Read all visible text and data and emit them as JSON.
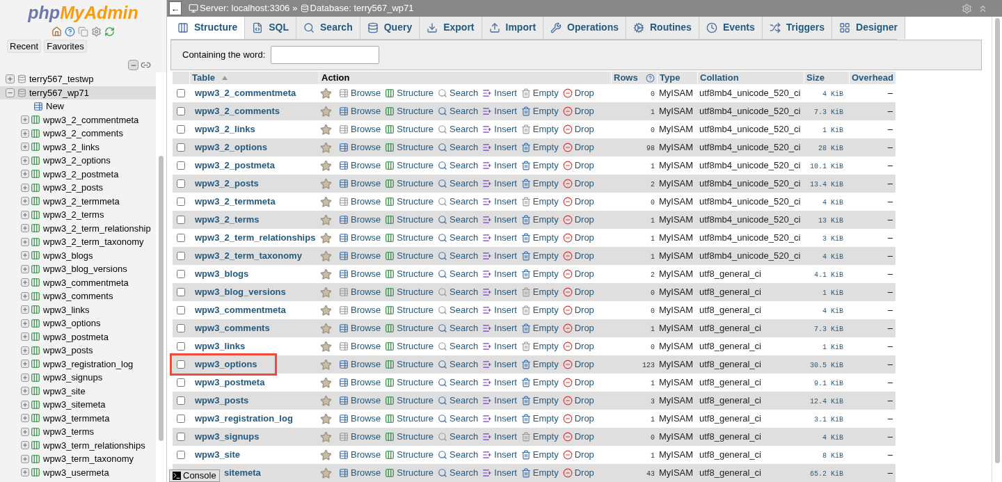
{
  "sidebar": {
    "logo": [
      "php",
      "MyAdmin"
    ],
    "buttons": [
      "Recent",
      "Favorites"
    ],
    "databases": [
      {
        "name": "terry567_testwp",
        "expanded": false,
        "selected": false
      },
      {
        "name": "terry567_wp71",
        "expanded": true,
        "selected": true,
        "children": [
          {
            "kind": "new",
            "name": "New"
          },
          {
            "kind": "table",
            "name": "wpw3_2_commentmeta"
          },
          {
            "kind": "table",
            "name": "wpw3_2_comments"
          },
          {
            "kind": "table",
            "name": "wpw3_2_links"
          },
          {
            "kind": "table",
            "name": "wpw3_2_options"
          },
          {
            "kind": "table",
            "name": "wpw3_2_postmeta"
          },
          {
            "kind": "table",
            "name": "wpw3_2_posts"
          },
          {
            "kind": "table",
            "name": "wpw3_2_termmeta"
          },
          {
            "kind": "table",
            "name": "wpw3_2_terms"
          },
          {
            "kind": "table",
            "name": "wpw3_2_term_relationship"
          },
          {
            "kind": "table",
            "name": "wpw3_2_term_taxonomy"
          },
          {
            "kind": "table",
            "name": "wpw3_blogs"
          },
          {
            "kind": "table",
            "name": "wpw3_blog_versions"
          },
          {
            "kind": "table",
            "name": "wpw3_commentmeta"
          },
          {
            "kind": "table",
            "name": "wpw3_comments"
          },
          {
            "kind": "table",
            "name": "wpw3_links"
          },
          {
            "kind": "table",
            "name": "wpw3_options"
          },
          {
            "kind": "table",
            "name": "wpw3_postmeta"
          },
          {
            "kind": "table",
            "name": "wpw3_posts"
          },
          {
            "kind": "table",
            "name": "wpw3_registration_log"
          },
          {
            "kind": "table",
            "name": "wpw3_signups"
          },
          {
            "kind": "table",
            "name": "wpw3_site"
          },
          {
            "kind": "table",
            "name": "wpw3_sitemeta"
          },
          {
            "kind": "table",
            "name": "wpw3_termmeta"
          },
          {
            "kind": "table",
            "name": "wpw3_terms"
          },
          {
            "kind": "table",
            "name": "wpw3_term_relationships"
          },
          {
            "kind": "table",
            "name": "wpw3_term_taxonomy"
          },
          {
            "kind": "table",
            "name": "wpw3_usermeta"
          }
        ]
      }
    ]
  },
  "breadcrumb": {
    "back": "←",
    "server": "Server: localhost:3306",
    "separator": "»",
    "database": "Database: terry567_wp71"
  },
  "tabs": [
    {
      "label": "Structure",
      "selected": true
    },
    {
      "label": "SQL",
      "selected": false
    },
    {
      "label": "Search",
      "selected": false
    },
    {
      "label": "Query",
      "selected": false
    },
    {
      "label": "Export",
      "selected": false
    },
    {
      "label": "Import",
      "selected": false
    },
    {
      "label": "Operations",
      "selected": false
    },
    {
      "label": "Routines",
      "selected": false
    },
    {
      "label": "Events",
      "selected": false
    },
    {
      "label": "Triggers",
      "selected": false
    },
    {
      "label": "Designer",
      "selected": false
    }
  ],
  "filter": {
    "label": "Containing the word:"
  },
  "table": {
    "columns": [
      "Table",
      "Action",
      "Rows",
      "Type",
      "Collation",
      "Size",
      "Overhead"
    ],
    "rows": [
      {
        "checked": false,
        "name": "wpw3_2_commentmeta",
        "actions": [
          "Browse",
          "Structure",
          "Search",
          "Insert",
          "Empty",
          "Drop"
        ],
        "rows": "0",
        "type": "MyISAM",
        "collation": "utf8mb4_unicode_520_ci",
        "size": "4 KiB",
        "overhead": "–",
        "empty": true,
        "highlighted": false
      },
      {
        "checked": false,
        "name": "wpw3_2_comments",
        "actions": [
          "Browse",
          "Structure",
          "Search",
          "Insert",
          "Empty",
          "Drop"
        ],
        "rows": "1",
        "type": "MyISAM",
        "collation": "utf8mb4_unicode_520_ci",
        "size": "7.3 KiB",
        "overhead": "–",
        "empty": false,
        "highlighted": false
      },
      {
        "checked": false,
        "name": "wpw3_2_links",
        "actions": [
          "Browse",
          "Structure",
          "Search",
          "Insert",
          "Empty",
          "Drop"
        ],
        "rows": "0",
        "type": "MyISAM",
        "collation": "utf8mb4_unicode_520_ci",
        "size": "1 KiB",
        "overhead": "–",
        "empty": true,
        "highlighted": false
      },
      {
        "checked": false,
        "name": "wpw3_2_options",
        "actions": [
          "Browse",
          "Structure",
          "Search",
          "Insert",
          "Empty",
          "Drop"
        ],
        "rows": "98",
        "type": "MyISAM",
        "collation": "utf8mb4_unicode_520_ci",
        "size": "28 KiB",
        "overhead": "–",
        "empty": false,
        "highlighted": false
      },
      {
        "checked": false,
        "name": "wpw3_2_postmeta",
        "actions": [
          "Browse",
          "Structure",
          "Search",
          "Insert",
          "Empty",
          "Drop"
        ],
        "rows": "1",
        "type": "MyISAM",
        "collation": "utf8mb4_unicode_520_ci",
        "size": "10.1 KiB",
        "overhead": "–",
        "empty": false,
        "highlighted": false
      },
      {
        "checked": false,
        "name": "wpw3_2_posts",
        "actions": [
          "Browse",
          "Structure",
          "Search",
          "Insert",
          "Empty",
          "Drop"
        ],
        "rows": "2",
        "type": "MyISAM",
        "collation": "utf8mb4_unicode_520_ci",
        "size": "13.4 KiB",
        "overhead": "–",
        "empty": false,
        "highlighted": false
      },
      {
        "checked": false,
        "name": "wpw3_2_termmeta",
        "actions": [
          "Browse",
          "Structure",
          "Search",
          "Insert",
          "Empty",
          "Drop"
        ],
        "rows": "0",
        "type": "MyISAM",
        "collation": "utf8mb4_unicode_520_ci",
        "size": "4 KiB",
        "overhead": "–",
        "empty": true,
        "highlighted": false
      },
      {
        "checked": false,
        "name": "wpw3_2_terms",
        "actions": [
          "Browse",
          "Structure",
          "Search",
          "Insert",
          "Empty",
          "Drop"
        ],
        "rows": "1",
        "type": "MyISAM",
        "collation": "utf8mb4_unicode_520_ci",
        "size": "13 KiB",
        "overhead": "–",
        "empty": false,
        "highlighted": false
      },
      {
        "checked": false,
        "name": "wpw3_2_term_relationships",
        "actions": [
          "Browse",
          "Structure",
          "Search",
          "Insert",
          "Empty",
          "Drop"
        ],
        "rows": "1",
        "type": "MyISAM",
        "collation": "utf8mb4_unicode_520_ci",
        "size": "3 KiB",
        "overhead": "–",
        "empty": false,
        "highlighted": false
      },
      {
        "checked": false,
        "name": "wpw3_2_term_taxonomy",
        "actions": [
          "Browse",
          "Structure",
          "Search",
          "Insert",
          "Empty",
          "Drop"
        ],
        "rows": "1",
        "type": "MyISAM",
        "collation": "utf8mb4_unicode_520_ci",
        "size": "4 KiB",
        "overhead": "–",
        "empty": false,
        "highlighted": false
      },
      {
        "checked": false,
        "name": "wpw3_blogs",
        "actions": [
          "Browse",
          "Structure",
          "Search",
          "Insert",
          "Empty",
          "Drop"
        ],
        "rows": "2",
        "type": "MyISAM",
        "collation": "utf8_general_ci",
        "size": "4.1 KiB",
        "overhead": "–",
        "empty": false,
        "highlighted": false
      },
      {
        "checked": false,
        "name": "wpw3_blog_versions",
        "actions": [
          "Browse",
          "Structure",
          "Search",
          "Insert",
          "Empty",
          "Drop"
        ],
        "rows": "0",
        "type": "MyISAM",
        "collation": "utf8_general_ci",
        "size": "1 KiB",
        "overhead": "–",
        "empty": true,
        "highlighted": false
      },
      {
        "checked": false,
        "name": "wpw3_commentmeta",
        "actions": [
          "Browse",
          "Structure",
          "Search",
          "Insert",
          "Empty",
          "Drop"
        ],
        "rows": "0",
        "type": "MyISAM",
        "collation": "utf8_general_ci",
        "size": "4 KiB",
        "overhead": "–",
        "empty": true,
        "highlighted": false
      },
      {
        "checked": false,
        "name": "wpw3_comments",
        "actions": [
          "Browse",
          "Structure",
          "Search",
          "Insert",
          "Empty",
          "Drop"
        ],
        "rows": "1",
        "type": "MyISAM",
        "collation": "utf8_general_ci",
        "size": "7.3 KiB",
        "overhead": "–",
        "empty": false,
        "highlighted": false
      },
      {
        "checked": false,
        "name": "wpw3_links",
        "actions": [
          "Browse",
          "Structure",
          "Search",
          "Insert",
          "Empty",
          "Drop"
        ],
        "rows": "0",
        "type": "MyISAM",
        "collation": "utf8_general_ci",
        "size": "1 KiB",
        "overhead": "–",
        "empty": true,
        "highlighted": false
      },
      {
        "checked": false,
        "name": "wpw3_options",
        "actions": [
          "Browse",
          "Structure",
          "Search",
          "Insert",
          "Empty",
          "Drop"
        ],
        "rows": "123",
        "type": "MyISAM",
        "collation": "utf8_general_ci",
        "size": "30.5 KiB",
        "overhead": "–",
        "empty": false,
        "highlighted": true
      },
      {
        "checked": false,
        "name": "wpw3_postmeta",
        "actions": [
          "Browse",
          "Structure",
          "Search",
          "Insert",
          "Empty",
          "Drop"
        ],
        "rows": "1",
        "type": "MyISAM",
        "collation": "utf8_general_ci",
        "size": "9.1 KiB",
        "overhead": "–",
        "empty": false,
        "highlighted": false
      },
      {
        "checked": false,
        "name": "wpw3_posts",
        "actions": [
          "Browse",
          "Structure",
          "Search",
          "Insert",
          "Empty",
          "Drop"
        ],
        "rows": "3",
        "type": "MyISAM",
        "collation": "utf8_general_ci",
        "size": "12.4 KiB",
        "overhead": "–",
        "empty": false,
        "highlighted": false
      },
      {
        "checked": false,
        "name": "wpw3_registration_log",
        "actions": [
          "Browse",
          "Structure",
          "Search",
          "Insert",
          "Empty",
          "Drop"
        ],
        "rows": "1",
        "type": "MyISAM",
        "collation": "utf8_general_ci",
        "size": "3.1 KiB",
        "overhead": "–",
        "empty": false,
        "highlighted": false
      },
      {
        "checked": false,
        "name": "wpw3_signups",
        "actions": [
          "Browse",
          "Structure",
          "Search",
          "Insert",
          "Empty",
          "Drop"
        ],
        "rows": "0",
        "type": "MyISAM",
        "collation": "utf8_general_ci",
        "size": "4 KiB",
        "overhead": "–",
        "empty": true,
        "highlighted": false
      },
      {
        "checked": false,
        "name": "wpw3_site",
        "actions": [
          "Browse",
          "Structure",
          "Search",
          "Insert",
          "Empty",
          "Drop"
        ],
        "rows": "1",
        "type": "MyISAM",
        "collation": "utf8_general_ci",
        "size": "8 KiB",
        "overhead": "–",
        "empty": false,
        "highlighted": false
      },
      {
        "name": "sitemeta",
        "actions": [
          "Browse",
          "Structure",
          "Search",
          "Insert",
          "Empty",
          "Drop"
        ],
        "rows": "43",
        "type": "MyISAM",
        "collation": "utf8_general_ci",
        "size": "65.2 KiB",
        "overhead": "–",
        "empty": false,
        "highlighted": false
      }
    ]
  },
  "console": {
    "label": "Console"
  }
}
